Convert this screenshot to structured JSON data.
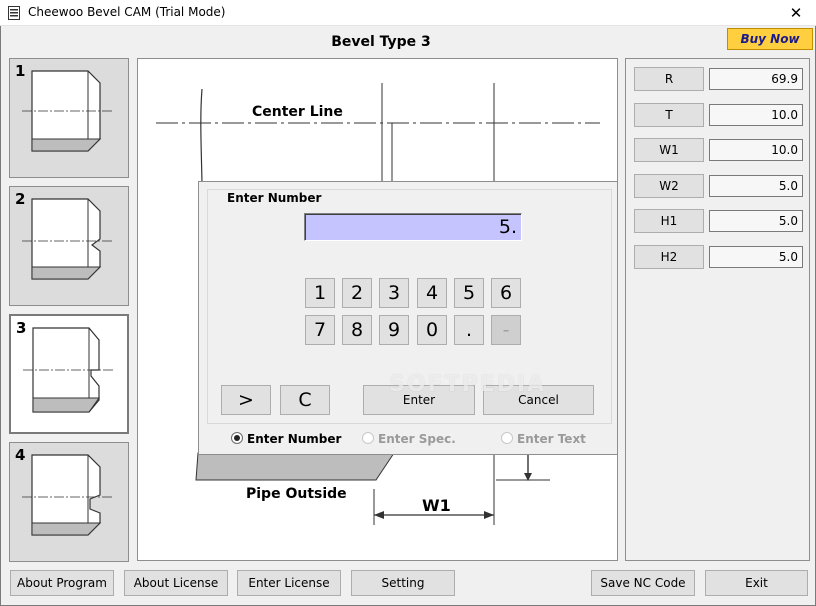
{
  "window": {
    "title": "Cheewoo Bevel CAM (Trial Mode)",
    "close_glyph": "✕",
    "icon": "app-document-icon"
  },
  "header": {
    "bevel_title": "Bevel Type 3",
    "buy_now": "Buy Now"
  },
  "bevel_types": [
    {
      "number": "1"
    },
    {
      "number": "2"
    },
    {
      "number": "3"
    },
    {
      "number": "4"
    }
  ],
  "selected_type": "3",
  "drawing": {
    "center_line": "Center Line",
    "pipe_outside": "Pipe Outside",
    "w1": "W1"
  },
  "dialog": {
    "group_title": "Enter Number",
    "display_value": "5.",
    "keys": [
      "1",
      "2",
      "3",
      "4",
      "5",
      "6",
      "7",
      "8",
      "9",
      "0",
      ".",
      "-"
    ],
    "next_label": ">",
    "clear_label": "C",
    "enter_label": "Enter",
    "cancel_label": "Cancel",
    "modes": {
      "number": "Enter Number",
      "spec": "Enter Spec.",
      "text": "Enter Text"
    },
    "selected_mode": "Enter Number",
    "watermark": "SOFTPEDIA"
  },
  "params": [
    {
      "label": "R",
      "value": "69.9"
    },
    {
      "label": "T",
      "value": "10.0"
    },
    {
      "label": "W1",
      "value": "10.0"
    },
    {
      "label": "W2",
      "value": "5.0"
    },
    {
      "label": "H1",
      "value": "5.0"
    },
    {
      "label": "H2",
      "value": "5.0"
    }
  ],
  "bottom_buttons": {
    "about_program": "About Program",
    "about_license": "About License",
    "enter_license": "Enter License",
    "setting": "Setting",
    "save_nc": "Save NC Code",
    "exit": "Exit"
  },
  "colors": {
    "buy_now_bg": "#ffcf3f",
    "display_bg": "#c6c4ff",
    "pipe_fill": "#bdbdbd"
  }
}
